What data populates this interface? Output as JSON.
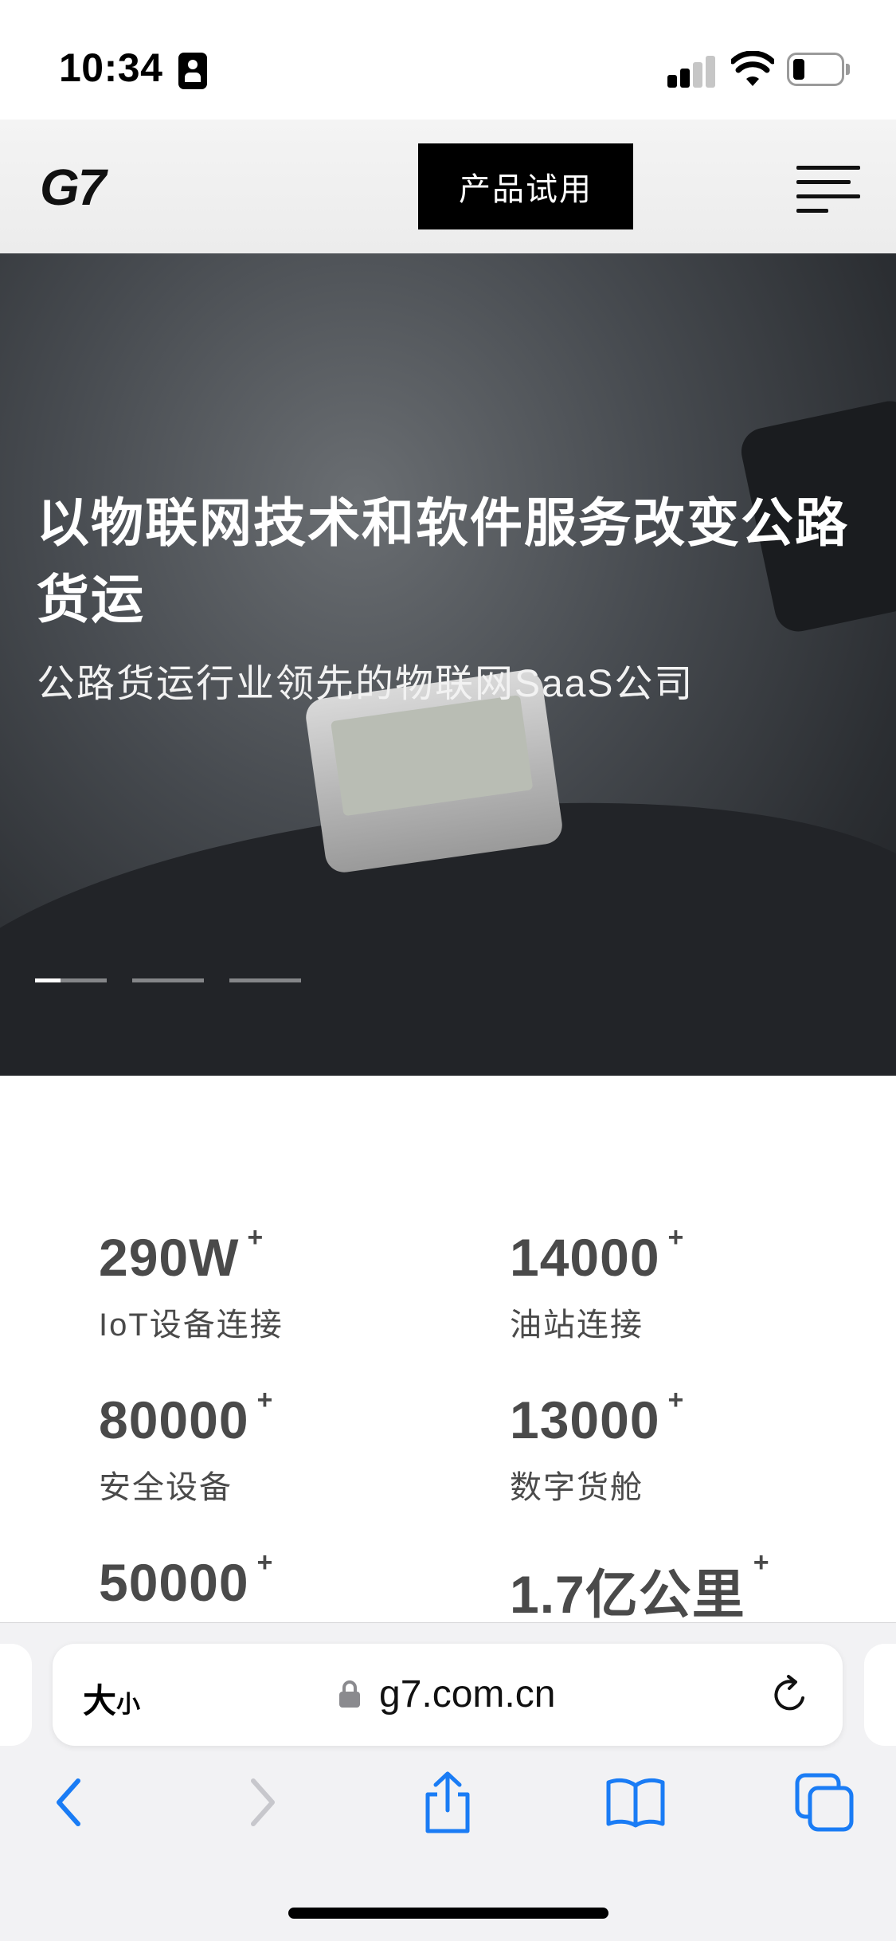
{
  "status_bar": {
    "time": "10:34"
  },
  "header": {
    "logo": "G7",
    "trial_button": "产品试用"
  },
  "hero": {
    "title": "以物联网技术和软件服务改变公路货运",
    "subtitle": "公路货运行业领先的物联网SaaS公司",
    "active_slide": 1,
    "slide_count": 3
  },
  "stats": {
    "plus": "+",
    "items": [
      {
        "value": "290W",
        "label": "IoT设备连接"
      },
      {
        "value": "14000",
        "label": "油站连接"
      },
      {
        "value": "80000",
        "label": "安全设备"
      },
      {
        "value": "13000",
        "label": "数字货舱"
      },
      {
        "value": "50000",
        "label": ""
      },
      {
        "value": "1.7亿公里",
        "label": ""
      }
    ]
  },
  "browser": {
    "text_size_big": "大",
    "text_size_small": "小",
    "url": "g7.com.cn"
  },
  "colors": {
    "accent": "#1a7cf5",
    "disabled": "#c7c7cc",
    "stat_text": "#4a4a4a"
  },
  "icons": [
    "badge-icon",
    "signal-icon",
    "wifi-icon",
    "battery-icon",
    "menu-icon",
    "lock-icon",
    "reload-icon",
    "back-icon",
    "forward-icon",
    "share-icon",
    "bookmarks-icon",
    "tabs-icon"
  ]
}
